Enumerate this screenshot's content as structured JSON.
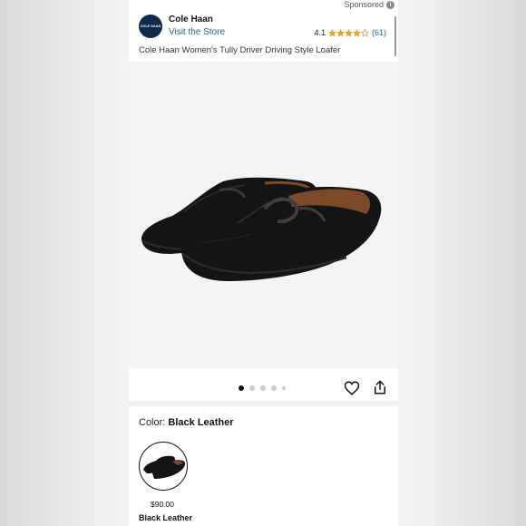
{
  "sponsored": {
    "label": "Sponsored",
    "info_icon": "info-icon"
  },
  "brand": {
    "logo_text": "COLE HAAN",
    "name": "Cole Haan",
    "visit_store": "Visit the Store",
    "rating": "4.1",
    "stars": 4,
    "rating_count": "(61)"
  },
  "product": {
    "title": "Cole Haan Women's Tully Driver Driving Style Loafer"
  },
  "carousel": {
    "total_images": 5,
    "active_index": 0
  },
  "actions": {
    "favorite_icon": "heart-icon",
    "share_icon": "share-icon"
  },
  "color": {
    "label": "Color: ",
    "value": "Black Leather"
  },
  "swatch": {
    "price": "$90.00",
    "name": "Black Leather"
  },
  "colors": {
    "link": "#1a6a8a",
    "star": "#f0a51c",
    "logo_bg": "#0f2a4a",
    "shoe": "#141414"
  }
}
